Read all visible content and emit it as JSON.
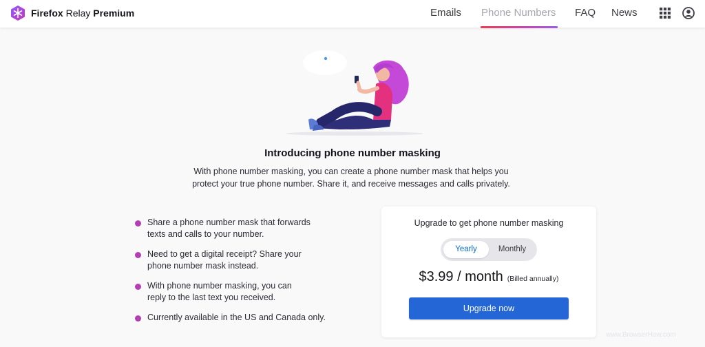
{
  "header": {
    "brand": {
      "part1": "Firefox",
      "part2": "Relay",
      "part3": "Premium",
      "icon": "relay-logo-icon"
    },
    "nav": [
      {
        "label": "Emails",
        "active": false
      },
      {
        "label": "Phone Numbers",
        "active": true
      },
      {
        "label": "FAQ",
        "active": false
      },
      {
        "label": "News",
        "active": false
      }
    ],
    "icons": [
      "apps-grid-icon",
      "account-icon"
    ]
  },
  "intro": {
    "title": "Introducing phone number masking",
    "line1": "With phone number masking, you can create a phone number mask that helps you",
    "line2": "protect your true phone number. Share it, and receive messages and calls privately."
  },
  "features": [
    {
      "line1": "Share a phone number mask that forwards",
      "line2": "texts and calls to your number."
    },
    {
      "line1": "Need to get a digital receipt? Share your",
      "line2": "phone number mask instead."
    },
    {
      "line1": "With phone number masking, you can",
      "line2": "reply to the last text you received."
    },
    {
      "line1": "Currently available in the US and Canada only.",
      "line2": ""
    }
  ],
  "plan_card": {
    "title": "Upgrade to get phone number masking",
    "toggle": {
      "yearly": "Yearly",
      "monthly": "Monthly",
      "selected": "Yearly"
    },
    "price": "$3.99 / month",
    "billing_note": "(Billed annually)",
    "cta": "Upgrade now"
  },
  "colors": {
    "accent_blue": "#2466d6",
    "bullet_purple": "#b33fb3",
    "nav_underline_start": "#e93e55",
    "nav_underline_end": "#9b5fe1"
  },
  "watermark": "www.BrowserHow.com"
}
